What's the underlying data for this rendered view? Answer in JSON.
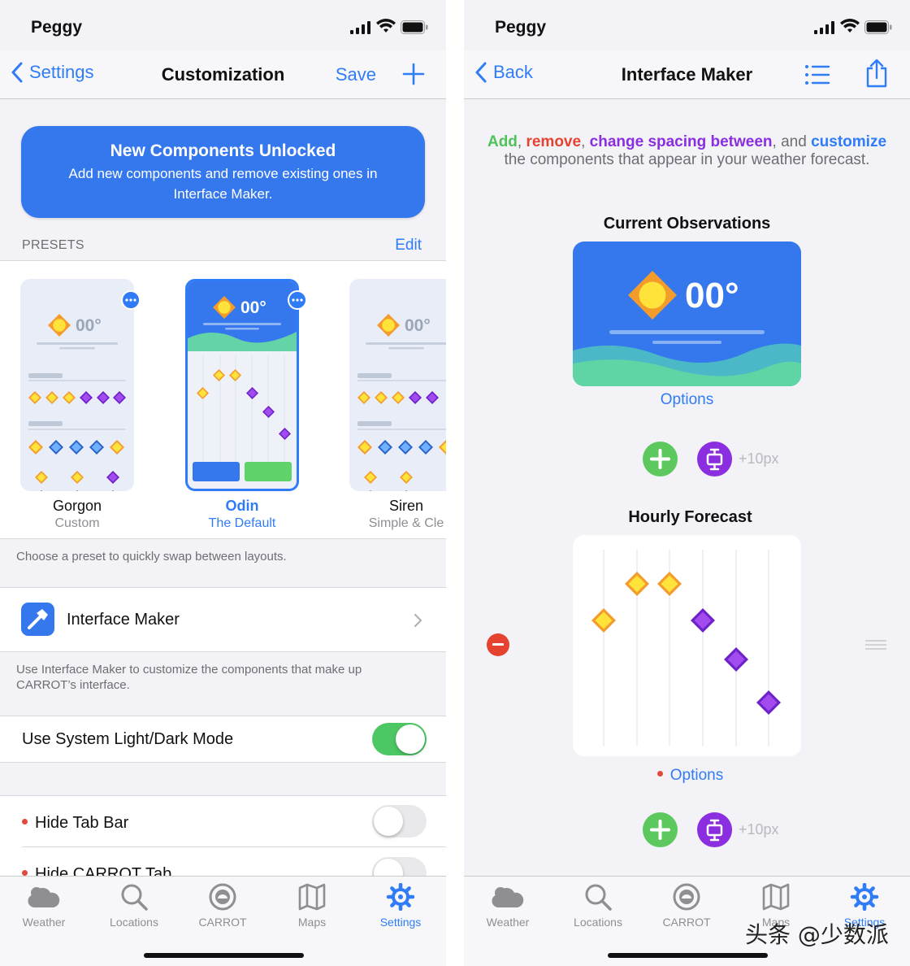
{
  "left": {
    "carrier": "Peggy",
    "nav": {
      "back_label": "Settings",
      "title": "Customization",
      "save_label": "Save"
    },
    "banner": {
      "title": "New Components Unlocked",
      "text": "Add new components and remove existing ones in Interface Maker."
    },
    "presets_header": "PRESETS",
    "presets_edit": "Edit",
    "presets": [
      {
        "name": "Gorgon",
        "subtitle": "Custom",
        "temp": "00°"
      },
      {
        "name": "Odin",
        "subtitle": "The Default",
        "temp": "00°"
      },
      {
        "name": "Siren",
        "subtitle": "Simple & Cle",
        "temp": "00°"
      }
    ],
    "presets_footnote": "Choose a preset to quickly swap between layouts.",
    "interface_maker_label": "Interface Maker",
    "interface_maker_footnote": "Use Interface Maker to customize the components that make up CARROT’s interface.",
    "light_dark": {
      "label": "Use System Light/Dark Mode",
      "on": true
    },
    "hide_tab_bar": {
      "label": "Hide Tab Bar",
      "on": false
    },
    "hide_carrot_tab": {
      "label": "Hide CARROT Tab",
      "on": false
    }
  },
  "right": {
    "carrier": "Peggy",
    "nav": {
      "back_label": "Back",
      "title": "Interface Maker"
    },
    "intro": {
      "add": "Add",
      "sep1": ", ",
      "remove": "remove",
      "sep2": ", ",
      "change": "change spacing between",
      "sep3": ", and ",
      "customize": "customize",
      "rest": "the components that appear in your weather forecast."
    },
    "current_obs": {
      "title": "Current Observations",
      "temp": "00°",
      "options": "Options"
    },
    "spacing_label_1": "+10px",
    "hourly": {
      "title": "Hourly Forecast",
      "options": "Options"
    },
    "spacing_label_2": "+10px"
  },
  "tabs": [
    {
      "label": "Weather",
      "icon": "cloud-icon"
    },
    {
      "label": "Locations",
      "icon": "search-icon"
    },
    {
      "label": "CARROT",
      "icon": "carrot-robot-icon"
    },
    {
      "label": "Maps",
      "icon": "map-icon"
    },
    {
      "label": "Settings",
      "icon": "gear-icon"
    }
  ],
  "watermark": "头条 @少数派",
  "colors": {
    "accent": "#2f7cf6",
    "banner": "#3577ec",
    "toggle_on": "#4cc764",
    "add_green": "#4fc25a",
    "remove_red": "#e5432f",
    "purple": "#8b2ee0",
    "yellow_diamond": "#f7c62f"
  }
}
